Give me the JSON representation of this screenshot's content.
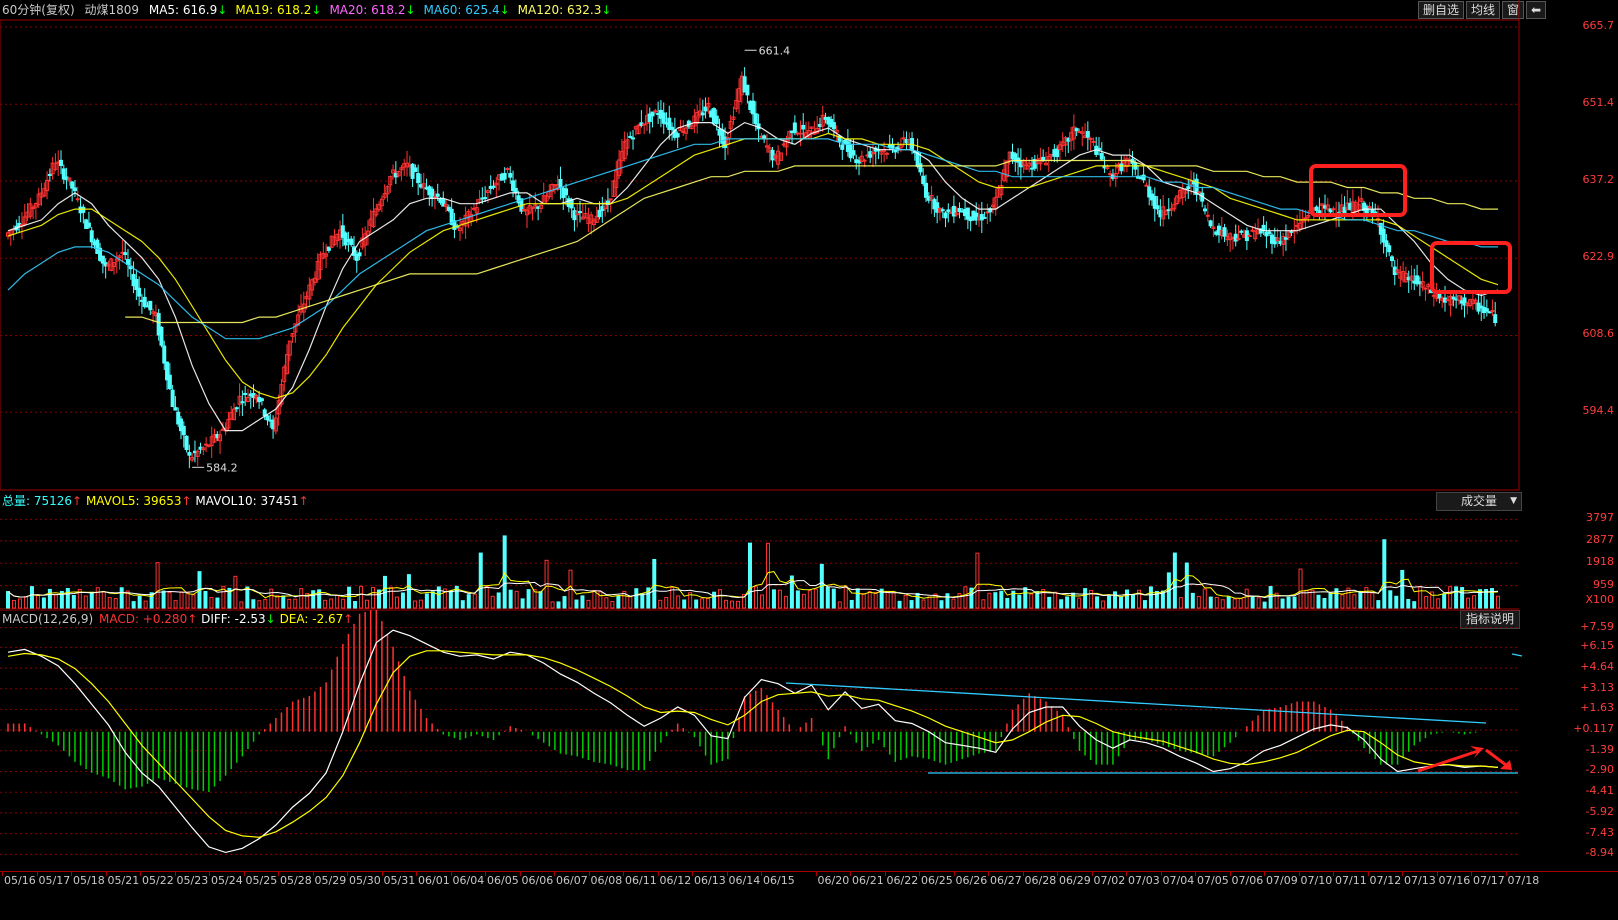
{
  "header": {
    "period": "60分钟(复权)",
    "symbol": "动煤1809",
    "ma": [
      {
        "label": "MA5: 616.9",
        "arrow": "↓",
        "color": "#ffffff"
      },
      {
        "label": "MA19: 618.2",
        "arrow": "↓",
        "color": "#ffff00"
      },
      {
        "label": "MA20: 618.2",
        "arrow": "↓",
        "color": "#ff66ff"
      },
      {
        "label": "MA60: 625.4",
        "arrow": "↓",
        "color": "#33ccff"
      },
      {
        "label": "MA120: 632.3",
        "arrow": "↓",
        "color": "#ffff66"
      }
    ],
    "buttons": [
      "删自选",
      "均线",
      "窗"
    ]
  },
  "price_axis": [
    "665.7",
    "651.4",
    "637.2",
    "622.9",
    "608.6",
    "594.4"
  ],
  "volume_header": {
    "total": "总量: 75126",
    "mavol5": "MAVOL5: 39653",
    "mavol10": "MAVOL10: 37451",
    "up_arrow": "↑",
    "dropdown": "成交量"
  },
  "volume_axis": [
    "3797",
    "2877",
    "1918",
    "959",
    "X100"
  ],
  "macd_header": {
    "name": "MACD(12,26,9)",
    "macd": "MACD: +0.280",
    "diff": "DIFF: -2.53",
    "dea": "DEA: -2.67",
    "help": "指标说明"
  },
  "macd_axis": [
    "+7.59",
    "+6.15",
    "+4.64",
    "+3.13",
    "+1.63",
    "+0.117",
    "-1.39",
    "-2.90",
    "-4.41",
    "-5.92",
    "-7.43",
    "-8.94"
  ],
  "dates": [
    "05/16",
    "05/17",
    "05/18",
    "05/21",
    "05/22",
    "05/23",
    "05/24",
    "05/25",
    "05/28",
    "05/29",
    "05/30",
    "05/31",
    "06/01",
    "06/04",
    "06/05",
    "06/06",
    "06/07",
    "06/08",
    "06/11",
    "06/12",
    "06/13",
    "06/14",
    "06/15",
    "06/20",
    "06/21",
    "06/22",
    "06/25",
    "06/26",
    "06/27",
    "06/28",
    "06/29",
    "07/02",
    "07/03",
    "07/04",
    "07/05",
    "07/06",
    "07/09",
    "07/10",
    "07/11",
    "07/12",
    "07/13",
    "07/16",
    "07/17",
    "07/18"
  ],
  "annotations": {
    "high": "661.4",
    "low": "584.2"
  },
  "chart_data": [
    {
      "type": "candlestick",
      "title": "动煤1809 60分钟(复权)",
      "ylim": [
        580.0,
        667.0
      ],
      "y_ticks": [
        665.7,
        651.4,
        637.2,
        622.9,
        608.6,
        594.4
      ],
      "marked_high": 661.4,
      "marked_low": 584.2,
      "close_path": [
        627,
        630,
        634,
        641,
        636,
        628,
        621,
        624,
        616,
        612,
        596,
        586,
        588,
        591,
        597,
        598,
        591,
        608,
        616,
        624,
        628,
        623,
        631,
        638,
        640,
        636,
        634,
        628,
        632,
        636,
        639,
        631,
        633,
        637,
        631,
        630,
        633,
        644,
        648,
        650,
        646,
        648,
        651,
        644,
        656,
        646,
        641,
        647,
        646,
        649,
        644,
        641,
        643,
        643,
        645,
        635,
        631,
        632,
        630,
        632,
        642,
        640,
        641,
        643,
        647,
        644,
        638,
        641,
        637,
        631,
        634,
        637,
        629,
        627,
        627,
        628,
        626,
        628,
        632,
        632,
        632,
        633,
        630,
        620,
        619,
        617,
        615,
        615,
        614,
        612
      ],
      "series": [
        {
          "name": "MA5",
          "color": "#ffffff",
          "values": [
            628,
            629,
            630,
            633,
            635,
            633,
            629,
            626,
            623,
            619,
            612,
            603,
            596,
            591,
            591,
            593,
            595,
            599,
            606,
            614,
            621,
            626,
            628,
            630,
            633,
            634,
            634,
            633,
            633,
            634,
            635,
            635,
            633,
            633,
            634,
            633,
            633,
            636,
            640,
            644,
            647,
            648,
            648,
            646,
            648,
            647,
            645,
            644,
            646,
            647,
            645,
            644,
            643,
            643,
            643,
            641,
            637,
            634,
            632,
            632,
            634,
            636,
            638,
            640,
            642,
            643,
            642,
            642,
            640,
            637,
            636,
            635,
            633,
            631,
            629,
            628,
            628,
            628,
            629,
            630,
            631,
            632,
            632,
            629,
            626,
            622,
            619,
            617,
            616,
            617
          ]
        },
        {
          "name": "MA19",
          "color": "#ffff00",
          "values": [
            627,
            628,
            629,
            631,
            632,
            632,
            630,
            628,
            626,
            623,
            619,
            614,
            609,
            604,
            600,
            598,
            597,
            598,
            601,
            605,
            610,
            614,
            618,
            621,
            624,
            626,
            628,
            629,
            630,
            631,
            632,
            633,
            633,
            633,
            633,
            633,
            633,
            634,
            636,
            638,
            640,
            642,
            643,
            644,
            645,
            645,
            645,
            645,
            645,
            646,
            645,
            645,
            644,
            644,
            644,
            643,
            641,
            639,
            637,
            636,
            636,
            636,
            637,
            638,
            639,
            640,
            640,
            640,
            640,
            639,
            638,
            637,
            636,
            634,
            633,
            632,
            631,
            630,
            630,
            630,
            630,
            630,
            630,
            629,
            627,
            625,
            623,
            621,
            619,
            618
          ]
        },
        {
          "name": "MA60",
          "color": "#33ccff",
          "values": [
            617,
            620,
            622,
            624,
            625,
            625,
            624,
            622,
            620,
            618,
            615,
            612,
            610,
            608,
            608,
            608,
            609,
            610,
            612,
            614,
            617,
            620,
            622,
            624,
            626,
            628,
            629,
            630,
            631,
            632,
            633,
            634,
            635,
            636,
            637,
            638,
            639,
            640,
            641,
            642,
            643,
            644,
            644,
            645,
            645,
            645,
            645,
            645,
            645,
            645,
            644,
            644,
            644,
            643,
            643,
            642,
            641,
            640,
            639,
            639,
            638,
            638,
            638,
            638,
            638,
            638,
            638,
            638,
            638,
            637,
            637,
            636,
            636,
            635,
            634,
            633,
            632,
            632,
            631,
            631,
            630,
            630,
            629,
            628,
            628,
            627,
            626,
            626,
            625,
            625
          ]
        },
        {
          "name": "MA120",
          "color": "#ffff66",
          "values": [
            null,
            null,
            null,
            null,
            null,
            null,
            null,
            612,
            612,
            611,
            611,
            611,
            611,
            611,
            611,
            612,
            612,
            613,
            614,
            615,
            616,
            617,
            618,
            619,
            620,
            620,
            620,
            620,
            620,
            621,
            622,
            623,
            624,
            625,
            626,
            628,
            630,
            632,
            634,
            635,
            636,
            637,
            638,
            638,
            639,
            639,
            639,
            640,
            640,
            640,
            640,
            640,
            640,
            640,
            640,
            640,
            640,
            640,
            640,
            640,
            641,
            641,
            641,
            641,
            641,
            641,
            641,
            641,
            640,
            640,
            640,
            640,
            639,
            639,
            639,
            638,
            638,
            637,
            637,
            637,
            636,
            636,
            635,
            635,
            634,
            634,
            633,
            633,
            632,
            632
          ]
        }
      ]
    },
    {
      "type": "bar",
      "title": "成交量",
      "y_ticks": [
        3797,
        2877,
        1918,
        959
      ],
      "unit": "X100",
      "total": 75126,
      "mavol5": 39653,
      "mavol10": 37451
    },
    {
      "type": "bar",
      "title": "MACD(12,26,9)",
      "ylim": [
        -9.5,
        8.0
      ],
      "y_ticks": [
        7.59,
        6.15,
        4.64,
        3.13,
        1.63,
        0.117,
        -1.39,
        -2.9,
        -4.41,
        -5.92,
        -7.43,
        -8.94
      ],
      "macd": 0.28,
      "diff": -2.53,
      "dea": -2.67,
      "series": [
        {
          "name": "DIFF",
          "color": "#ffffff",
          "values": [
            5.8,
            6.0,
            5.5,
            4.8,
            3.5,
            2.0,
            0.5,
            -1.5,
            -3.0,
            -4.0,
            -5.5,
            -7.0,
            -8.4,
            -8.8,
            -8.5,
            -7.8,
            -6.8,
            -5.5,
            -4.5,
            -3.0,
            0.0,
            3.5,
            6.5,
            7.4,
            7.0,
            6.4,
            5.8,
            5.5,
            5.6,
            5.3,
            5.8,
            5.6,
            5.0,
            4.2,
            3.6,
            2.8,
            2.1,
            1.2,
            0.4,
            1.0,
            1.8,
            1.2,
            -0.3,
            -0.5,
            2.5,
            3.8,
            3.5,
            2.8,
            3.4,
            1.6,
            2.9,
            1.7,
            2.0,
            0.8,
            0.6,
            0.0,
            -0.8,
            -1.0,
            -1.2,
            -1.5,
            0.2,
            1.4,
            1.8,
            1.8,
            0.4,
            -0.6,
            -1.2,
            -0.6,
            -0.8,
            -1.2,
            -1.8,
            -2.3,
            -2.9,
            -2.7,
            -2.2,
            -1.4,
            -1.0,
            -0.4,
            0.2,
            0.5,
            0.3,
            -0.6,
            -2.0,
            -2.9,
            -2.7,
            -2.5,
            -2.4,
            -2.6,
            -2.5,
            -2.6
          ]
        },
        {
          "name": "DEA",
          "color": "#ffff00",
          "values": [
            5.5,
            5.7,
            5.6,
            5.3,
            4.6,
            3.5,
            2.2,
            0.6,
            -1.0,
            -2.3,
            -3.6,
            -4.9,
            -6.2,
            -7.2,
            -7.6,
            -7.7,
            -7.3,
            -6.6,
            -5.8,
            -4.8,
            -3.2,
            -0.8,
            2.0,
            4.3,
            5.5,
            5.9,
            5.9,
            5.8,
            5.7,
            5.6,
            5.6,
            5.6,
            5.4,
            5.0,
            4.5,
            3.9,
            3.3,
            2.6,
            1.8,
            1.4,
            1.5,
            1.4,
            0.9,
            0.5,
            1.2,
            2.2,
            2.7,
            2.8,
            2.9,
            2.6,
            2.7,
            2.4,
            2.3,
            1.9,
            1.5,
            1.0,
            0.4,
            0.0,
            -0.4,
            -0.8,
            -0.6,
            0.0,
            0.7,
            1.2,
            1.1,
            0.6,
            0.0,
            -0.3,
            -0.5,
            -0.7,
            -1.1,
            -1.5,
            -2.0,
            -2.3,
            -2.4,
            -2.2,
            -1.9,
            -1.5,
            -0.9,
            -0.3,
            0.1,
            0.0,
            -0.8,
            -1.7,
            -2.2,
            -2.4,
            -2.4,
            -2.5,
            -2.5,
            -2.6
          ]
        }
      ]
    }
  ]
}
